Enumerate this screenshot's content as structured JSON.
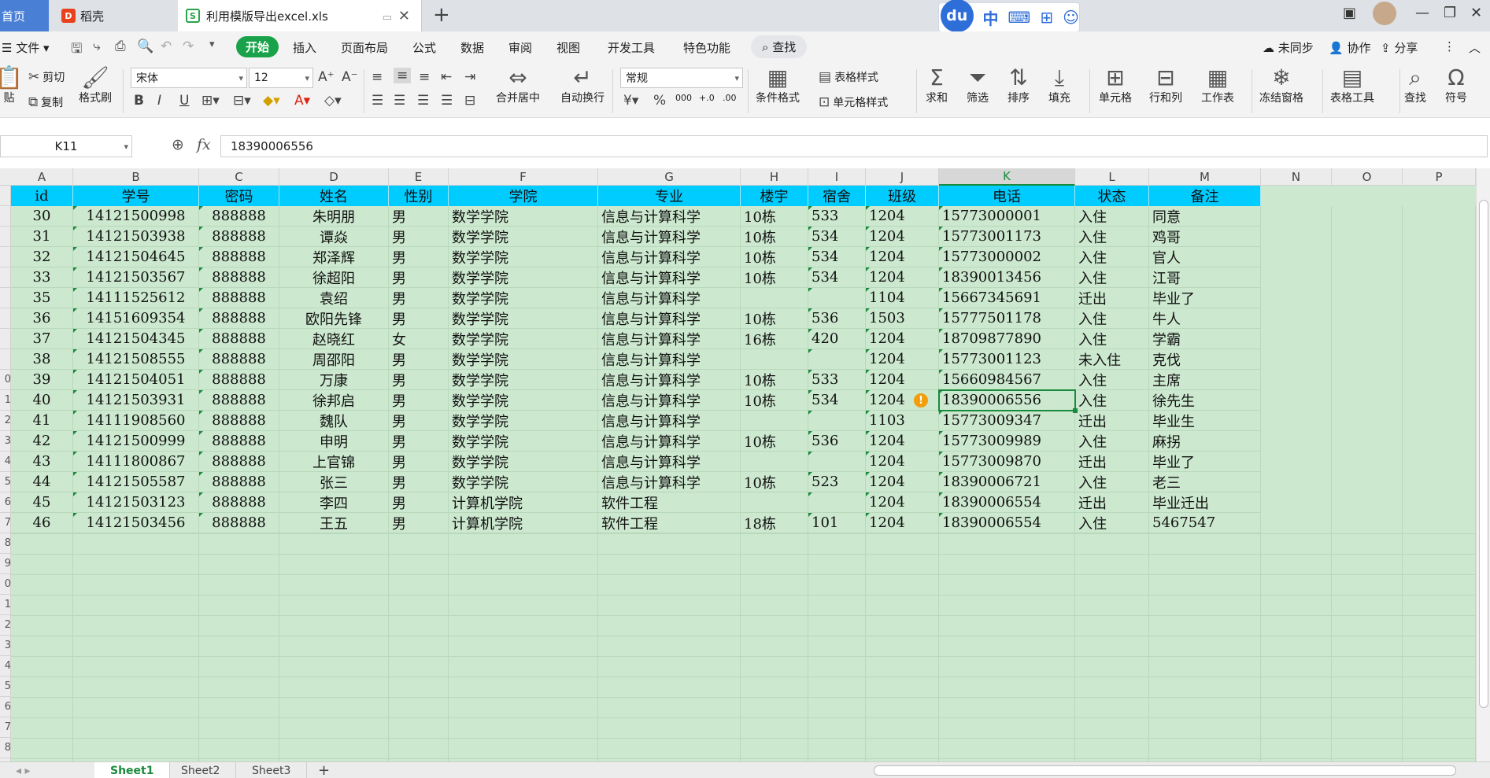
{
  "tabs": {
    "home": "首页",
    "daoke": "稻壳",
    "active": "利用模版导出excel.xls",
    "new_tab": "+"
  },
  "ime": {
    "logo": "du",
    "lang": "中"
  },
  "menu": {
    "file": "文件",
    "items": [
      "开始",
      "插入",
      "页面布局",
      "公式",
      "数据",
      "审阅",
      "视图",
      "开发工具",
      "特色功能"
    ],
    "search": "查找",
    "sync": "未同步",
    "collab": "协作",
    "share": "分享"
  },
  "ribbon": {
    "paste": "贴",
    "cut": "剪切",
    "copy": "复制",
    "format_painter": "格式刷",
    "font_name": "宋体",
    "font_size": "12",
    "merge": "合并居中",
    "wrap": "自动换行",
    "number_format": "常规",
    "cond_format": "条件格式",
    "table_style": "表格样式",
    "cell_style": "单元格样式",
    "sum": "求和",
    "filter": "筛选",
    "sort": "排序",
    "fill": "填充",
    "cell": "单元格",
    "row_col": "行和列",
    "worksheet": "工作表",
    "freeze": "冻结窗格",
    "table_tools": "表格工具",
    "find": "查找",
    "symbol": "符号"
  },
  "formula_bar": {
    "name_box": "K11",
    "value": "18390006556"
  },
  "columns": [
    "A",
    "B",
    "C",
    "D",
    "E",
    "F",
    "G",
    "H",
    "I",
    "J",
    "K",
    "L",
    "M",
    "N",
    "O",
    "P"
  ],
  "selected_column": "K",
  "table": {
    "headers": [
      "id",
      "学号",
      "密码",
      "姓名",
      "性别",
      "学院",
      "专业",
      "楼宇",
      "宿舍",
      "班级",
      "电话",
      "状态",
      "备注"
    ],
    "rows": [
      [
        "30",
        "14121500998",
        "888888",
        "朱明朋",
        "男",
        "数学学院",
        "信息与计算科学",
        "10栋",
        "533",
        "1204",
        "15773000001",
        "入住",
        "同意"
      ],
      [
        "31",
        "14121503938",
        "888888",
        "谭焱",
        "男",
        "数学学院",
        "信息与计算科学",
        "10栋",
        "534",
        "1204",
        "15773001173",
        "入住",
        "鸡哥"
      ],
      [
        "32",
        "14121504645",
        "888888",
        "郑泽辉",
        "男",
        "数学学院",
        "信息与计算科学",
        "10栋",
        "534",
        "1204",
        "15773000002",
        "入住",
        "官人"
      ],
      [
        "33",
        "14121503567",
        "888888",
        "徐超阳",
        "男",
        "数学学院",
        "信息与计算科学",
        "10栋",
        "534",
        "1204",
        "18390013456",
        "入住",
        "江哥"
      ],
      [
        "35",
        "14111525612",
        "888888",
        "袁绍",
        "男",
        "数学学院",
        "信息与计算科学",
        "",
        "",
        "1104",
        "15667345691",
        "迁出",
        "毕业了"
      ],
      [
        "36",
        "14151609354",
        "888888",
        "欧阳先锋",
        "男",
        "数学学院",
        "信息与计算科学",
        "10栋",
        "536",
        "1503",
        "15777501178",
        "入住",
        "牛人"
      ],
      [
        "37",
        "14121504345",
        "888888",
        "赵晓红",
        "女",
        "数学学院",
        "信息与计算科学",
        "16栋",
        "420",
        "1204",
        "18709877890",
        "入住",
        "学霸"
      ],
      [
        "38",
        "14121508555",
        "888888",
        "周邵阳",
        "男",
        "数学学院",
        "信息与计算科学",
        "",
        "",
        "1204",
        "15773001123",
        "未入住",
        "克伐"
      ],
      [
        "39",
        "14121504051",
        "888888",
        "万康",
        "男",
        "数学学院",
        "信息与计算科学",
        "10栋",
        "533",
        "1204",
        "15660984567",
        "入住",
        "主席"
      ],
      [
        "40",
        "14121503931",
        "888888",
        "徐邦启",
        "男",
        "数学学院",
        "信息与计算科学",
        "10栋",
        "534",
        "1204",
        "18390006556",
        "入住",
        "徐先生"
      ],
      [
        "41",
        "14111908560",
        "888888",
        "魏队",
        "男",
        "数学学院",
        "信息与计算科学",
        "",
        "",
        "1103",
        "15773009347",
        "迁出",
        "毕业生"
      ],
      [
        "42",
        "14121500999",
        "888888",
        "申明",
        "男",
        "数学学院",
        "信息与计算科学",
        "10栋",
        "536",
        "1204",
        "15773009989",
        "入住",
        "麻拐"
      ],
      [
        "43",
        "14111800867",
        "888888",
        "上官锦",
        "男",
        "数学学院",
        "信息与计算科学",
        "",
        "",
        "1204",
        "15773009870",
        "迁出",
        "毕业了"
      ],
      [
        "44",
        "14121505587",
        "888888",
        "张三",
        "男",
        "数学学院",
        "信息与计算科学",
        "10栋",
        "523",
        "1204",
        "18390006721",
        "入住",
        "老三"
      ],
      [
        "45",
        "14121503123",
        "888888",
        "李四",
        "男",
        "计算机学院",
        "软件工程",
        "",
        "",
        "1204",
        "18390006554",
        "迁出",
        "毕业迁出"
      ],
      [
        "46",
        "14121503456",
        "888888",
        "王五",
        "男",
        "计算机学院",
        "软件工程",
        "18栋",
        "101",
        "1204",
        "18390006554",
        "入住",
        "5467547"
      ]
    ]
  },
  "row_numbers": [
    "",
    "",
    "",
    "",
    "",
    "",
    "",
    "",
    "",
    "0",
    "1",
    "2",
    "3",
    "4",
    "5",
    "6",
    "7",
    "8",
    "9",
    "0",
    "1",
    "2",
    "3",
    "4",
    "5",
    "6",
    "7",
    "8"
  ],
  "sheets": [
    "Sheet1",
    "Sheet2",
    "Sheet3"
  ],
  "add_sheet": "+",
  "colors": {
    "header_bg": "#00ccff",
    "grid_bg": "#cce8cf",
    "accent": "#19a24a"
  }
}
